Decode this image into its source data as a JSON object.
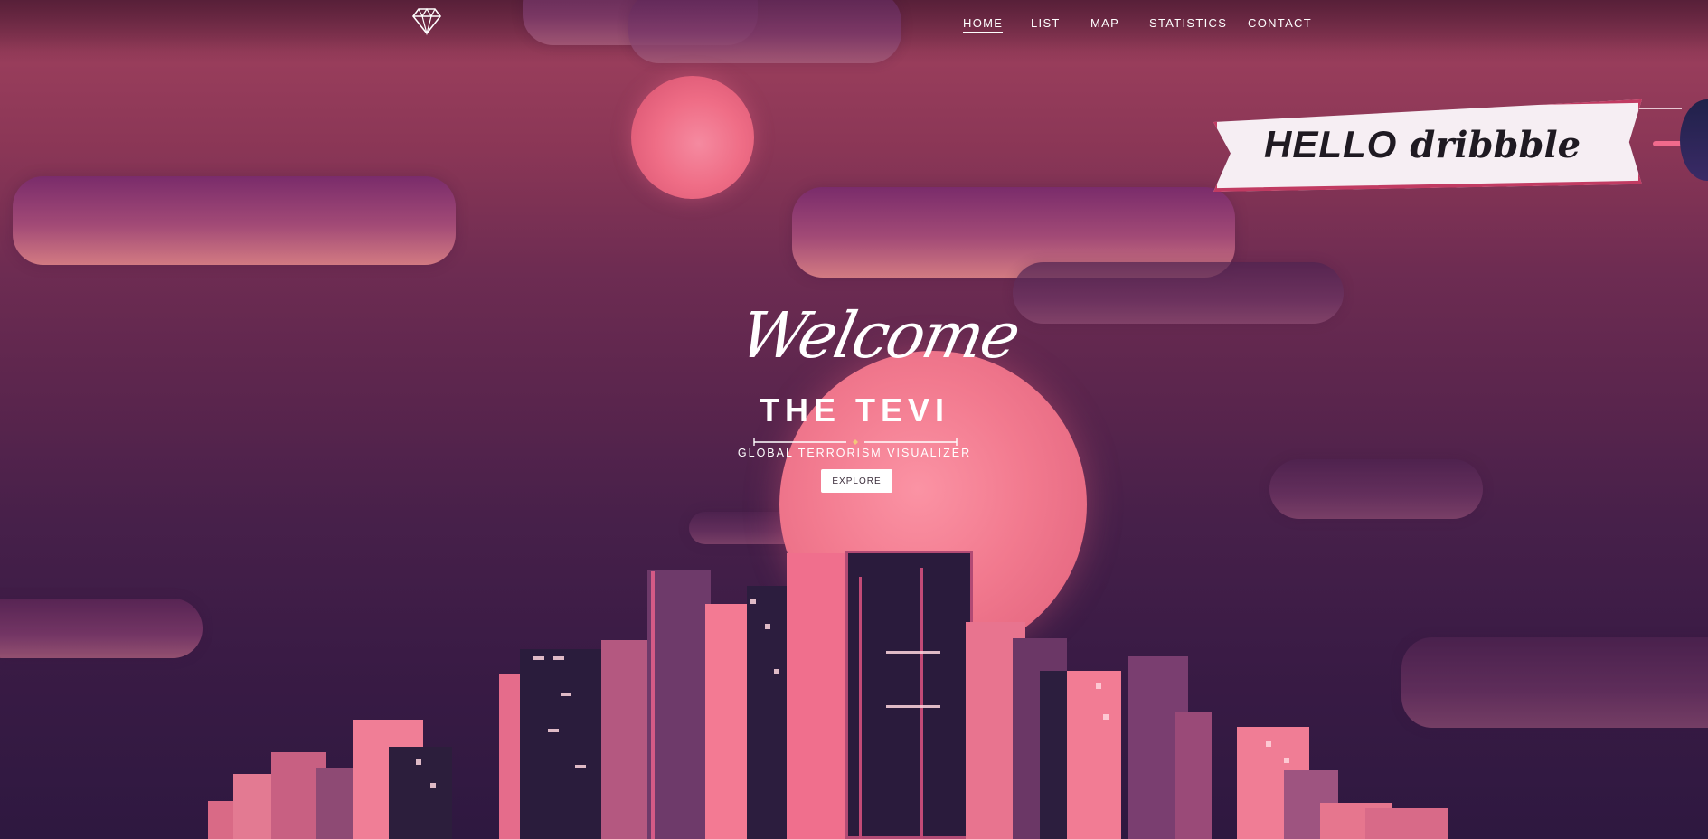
{
  "nav": {
    "logo_icon": "diamond-icon",
    "items": [
      {
        "label": "HOME",
        "active": true
      },
      {
        "label": "LIST",
        "active": false
      },
      {
        "label": "MAP",
        "active": false
      },
      {
        "label": "STATISTICS",
        "active": false
      },
      {
        "label": "CONTACT",
        "active": false
      }
    ]
  },
  "hero": {
    "welcome": "Welcome",
    "title": "THE TEVI",
    "subtitle": "GLOBAL TERRORISM VISUALIZER",
    "cta_label": "EXPLORE"
  },
  "banner": {
    "hello": "HELLO",
    "brand": "dribbble"
  },
  "colors": {
    "sky_top": "#9a3e5c",
    "sky_bottom": "#2e1840",
    "moon": "#f27a8f",
    "accent": "#c13b62"
  }
}
